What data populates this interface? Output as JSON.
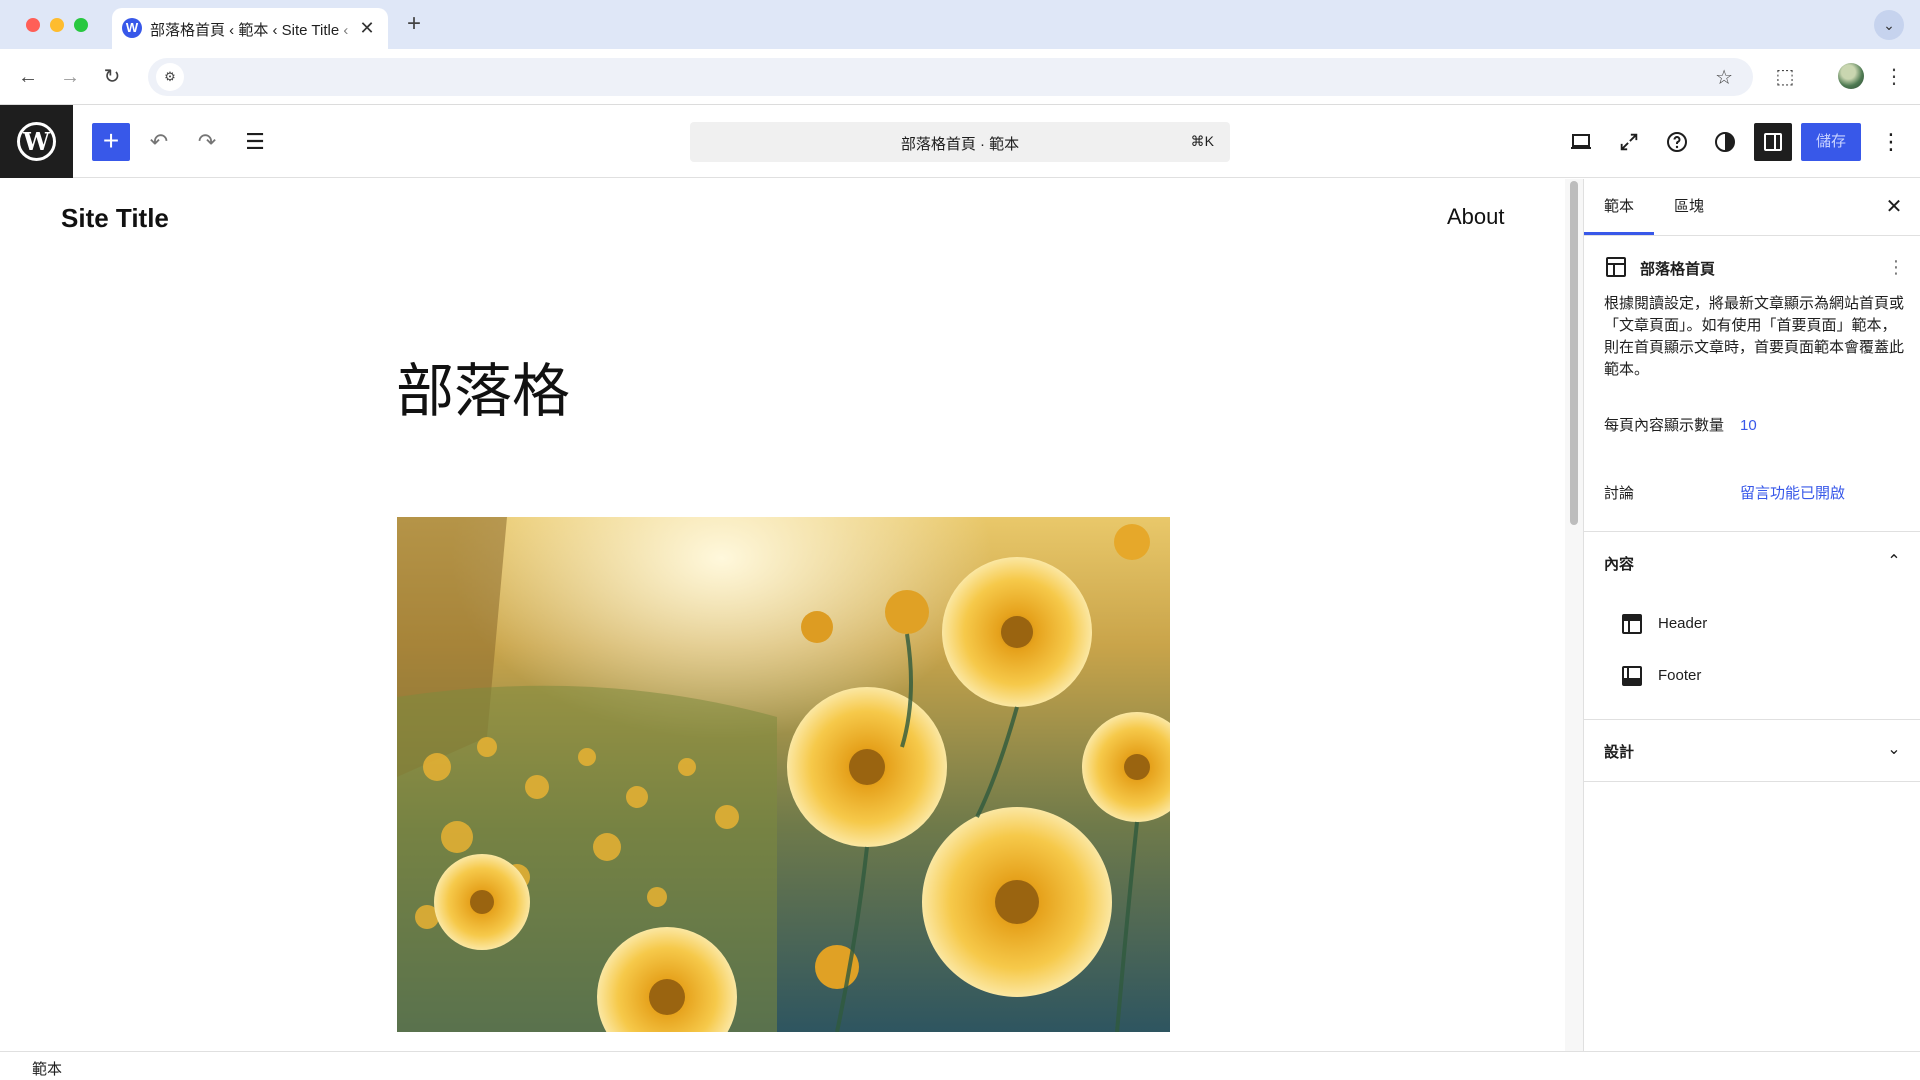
{
  "browser": {
    "tab_title": "部落格首頁 ‹ 範本 ‹ Site Title ‹",
    "tab_favicon": "W",
    "tab_close": "✕",
    "new_tab": "+",
    "tab_menu": "⌄",
    "nav_back": "←",
    "nav_forward": "→",
    "nav_reload": "↻",
    "site_info_icon": "⚙",
    "bookmark_icon": "☆",
    "extensions_icon": "⬚",
    "menu_icon": "⋮"
  },
  "editor_header": {
    "logo": "W",
    "add_block": "+",
    "undo": "↶",
    "redo": "↷",
    "list_view": "☰",
    "document_title": "部落格首頁 · 範本",
    "shortcut": "⌘K",
    "device_preview_icon": "desktop-icon",
    "fullscreen_icon": "expand-icon",
    "help_icon": "help-icon",
    "styles_icon": "contrast-icon",
    "save_label": "儲存",
    "more": "⋮"
  },
  "canvas": {
    "site_title": "Site Title",
    "nav_about": "About",
    "page_heading": "部落格"
  },
  "inspector": {
    "tabs": [
      {
        "label": "範本"
      },
      {
        "label": "區塊"
      }
    ],
    "close": "✕",
    "template_title": "部落格首頁",
    "template_more": "⋮",
    "description": "根據閱讀設定，將最新文章顯示為網站首頁或「文章頁面」。如有使用「首要頁面」範本，則在首頁顯示文章時，首要頁面範本會覆蓋此範本。",
    "posts_per_page_label": "每頁內容顯示數量",
    "posts_per_page_value": "10",
    "discussion_label": "討論",
    "discussion_value": "留言功能已開啟",
    "content_section": "內容",
    "content_chevron": "⌃",
    "parts": [
      {
        "label": "Header"
      },
      {
        "label": "Footer"
      }
    ],
    "design_section": "設計",
    "design_chevron": "⌄"
  },
  "status_bar": {
    "breadcrumb": "範本"
  },
  "colors": {
    "accent": "#3858e9",
    "dark": "#1e1e1e"
  }
}
